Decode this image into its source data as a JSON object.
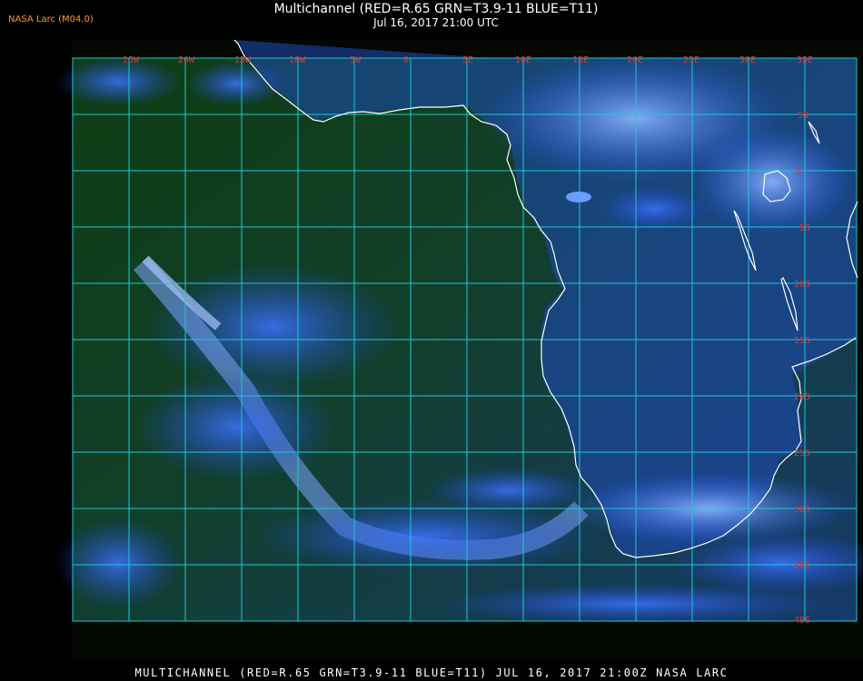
{
  "credit": "NASA Larc (M04.0)",
  "title": "Multichannel (RED=R.65 GRN=T3.9-11 BLUE=T11)",
  "subtitle": "Jul 16, 2017 21:00 UTC",
  "footer": "MULTICHANNEL (RED=R.65 GRN=T3.9-11 BLUE=T11) JUL 16, 2017 21:00Z   NASA LARC",
  "map": {
    "lon_labels": [
      "25W",
      "20W",
      "15W",
      "10W",
      "5W",
      "0",
      "5E",
      "10E",
      "15E",
      "20E",
      "25E",
      "30E",
      "35E"
    ],
    "lat_labels": [
      "5N",
      "0",
      "5S",
      "10S",
      "15S",
      "20S",
      "25S",
      "30S",
      "35S",
      "40S"
    ],
    "colors": {
      "grid": "#1ec8d8",
      "label": "#d63a3a",
      "coast": "#ffffff",
      "ocean": "#124a14",
      "cloud": "#3a7bff"
    }
  }
}
